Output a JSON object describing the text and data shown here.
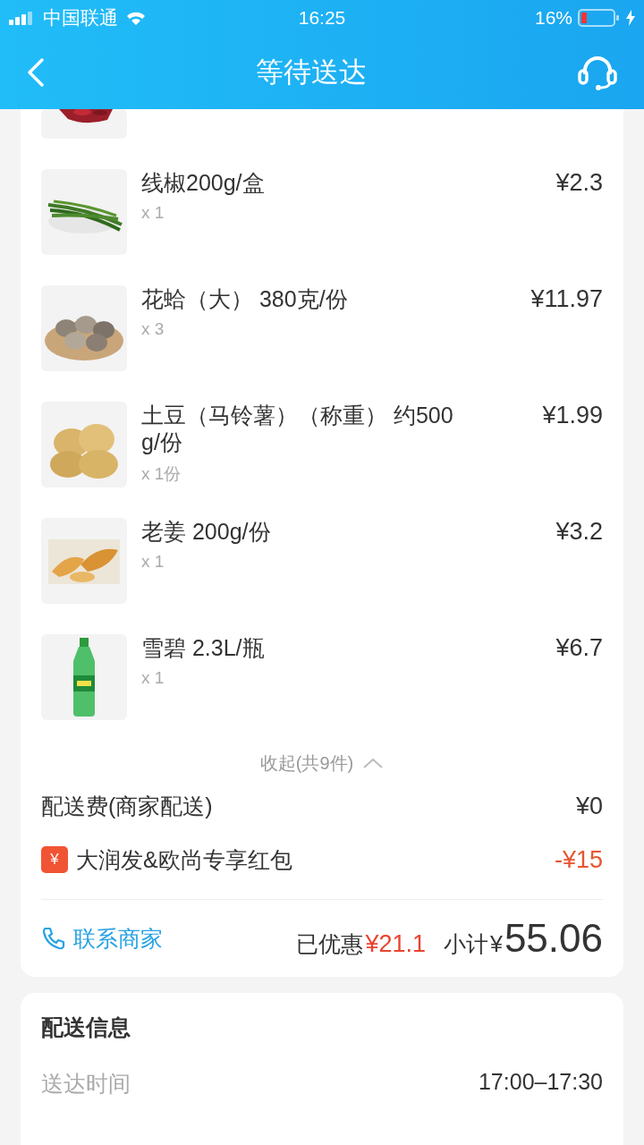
{
  "status_bar": {
    "carrier": "中国联通",
    "time": "16:25",
    "battery": "16%"
  },
  "nav": {
    "title": "等待送达"
  },
  "items": [
    {
      "name": "线椒200g/盒",
      "qty": "x 1",
      "price": "¥2.3"
    },
    {
      "name": "花蛤（大） 380克/份",
      "qty": "x 3",
      "price": "¥11.97"
    },
    {
      "name": "土豆（马铃薯）（称重） 约500g/份",
      "qty": "x 1份",
      "price": "¥1.99"
    },
    {
      "name": "老姜 200g/份",
      "qty": "x 1",
      "price": "¥3.2"
    },
    {
      "name": "雪碧 2.3L/瓶",
      "qty": "x 1",
      "price": "¥6.7"
    }
  ],
  "collapse": {
    "label": "收起(共9件)"
  },
  "fees": [
    {
      "kind": "plain",
      "label": "配送费(商家配送)",
      "amount": "¥0"
    },
    {
      "kind": "coupon",
      "badge": "¥",
      "label": "大润发&欧尚专享红包",
      "amount": "-¥15"
    }
  ],
  "footer": {
    "contact": "联系商家",
    "discount_label": "已优惠",
    "discount": "¥21.1",
    "subtotal_label": "小计",
    "currency": "¥",
    "subtotal": "55.06"
  },
  "delivery": {
    "title": "配送信息",
    "rows": [
      {
        "label": "送达时间",
        "value": "17:00–17:30"
      }
    ]
  }
}
